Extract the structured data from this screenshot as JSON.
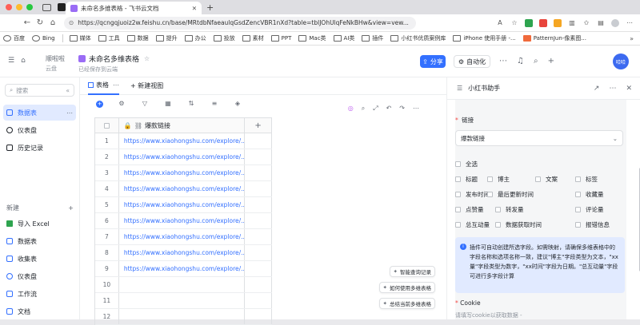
{
  "browser": {
    "tab_title": "未命名多维表格 - 飞书云文档",
    "url": "https://qcngqjuoiz2w.feishu.cn/base/MRtdbNfaeaulqGsdZencVBR1nXd?table=tblJOhUlqFeNkBHw&view=vew...",
    "colors": {
      "close": "#ff5f57",
      "min": "#febc2e",
      "max": "#28c840",
      "tab_icon": "#9a6cf5"
    }
  },
  "bookmarks": [
    {
      "label": "百度",
      "icon": "paw-icon"
    },
    {
      "label": "Bing",
      "icon": "search-icon"
    },
    {
      "label": "媒体",
      "icon": "folder-icon"
    },
    {
      "label": "工具",
      "icon": "folder-icon"
    },
    {
      "label": "数据",
      "icon": "folder-icon"
    },
    {
      "label": "提升",
      "icon": "folder-icon"
    },
    {
      "label": "办公",
      "icon": "folder-icon"
    },
    {
      "label": "投放",
      "icon": "folder-icon"
    },
    {
      "label": "素材",
      "icon": "folder-icon"
    },
    {
      "label": "PPT",
      "icon": "folder-icon"
    },
    {
      "label": "Mac类",
      "icon": "folder-icon"
    },
    {
      "label": "AI类",
      "icon": "folder-icon"
    },
    {
      "label": "插件",
      "icon": "folder-icon"
    },
    {
      "label": "小红书优质案例库",
      "icon": "grid-icon"
    },
    {
      "label": "iPhone 使用手册 -...",
      "icon": "apple-icon"
    },
    {
      "label": "PatternJun-像素图...",
      "icon": "pattern-icon"
    }
  ],
  "header": {
    "crumb": "顺啦啦",
    "crumb_sub": "云盘",
    "doc_title": "未命名多维表格",
    "doc_sub": "已经保存到云端",
    "share": "分享",
    "automation": "自动化",
    "avatar": "哈哈"
  },
  "sidebar": {
    "search_placeholder": "搜索",
    "items": [
      "数据表",
      "仪表盘",
      "历史记录"
    ],
    "new_label": "新建",
    "new_items": [
      "导入 Excel",
      "数据表",
      "收集表",
      "仪表盘",
      "工作流",
      "文档"
    ]
  },
  "main": {
    "tabs": [
      "表格",
      "+ 新建视图"
    ],
    "column_header": "爆款链接",
    "rows": [
      {
        "num": "1",
        "link": "https://www.xiaohongshu.com/explore/..."
      },
      {
        "num": "2",
        "link": "https://www.xiaohongshu.com/explore/..."
      },
      {
        "num": "3",
        "link": "https://www.xiaohongshu.com/explore/..."
      },
      {
        "num": "4",
        "link": "https://www.xiaohongshu.com/explore/..."
      },
      {
        "num": "5",
        "link": "https://www.xiaohongshu.com/explore/..."
      },
      {
        "num": "6",
        "link": "https://www.xiaohongshu.com/explore/..."
      },
      {
        "num": "7",
        "link": "https://www.xiaohongshu.com/explore/..."
      },
      {
        "num": "8",
        "link": "https://www.xiaohongshu.com/explore/..."
      },
      {
        "num": "9",
        "link": "https://www.xiaohongshu.com/explore/..."
      },
      {
        "num": "10",
        "link": ""
      },
      {
        "num": "11",
        "link": ""
      },
      {
        "num": "12",
        "link": ""
      }
    ],
    "float_buttons": [
      "智能查询记录",
      "如何使用多维表格",
      "总结当前多维表格"
    ]
  },
  "panel": {
    "title": "小红书助手",
    "link_label": "链接",
    "link_value": "爆款链接",
    "options": [
      [
        "全选"
      ],
      [
        "标题",
        "博主",
        "文案",
        "标签"
      ],
      [
        "发布时间",
        "最后更新时间",
        "收藏量"
      ],
      [
        "点赞量",
        "转发量",
        "评论量"
      ],
      [
        "总互动量",
        "数据获取时间",
        "报错信息"
      ]
    ],
    "info": "插件可自动创建所选字段。如需映射，请确保多维表格中的字段名称和选项名称一致，建议\"博主\"字段类型为文本，\"xx量\"字段类型为数字，\"xx时间\"字段为日期。\"总互动量\"字段可进行多字段计算",
    "cookie_label": "Cookie",
    "cookie_placeholder": "请填写cookie以获取数据 -"
  }
}
